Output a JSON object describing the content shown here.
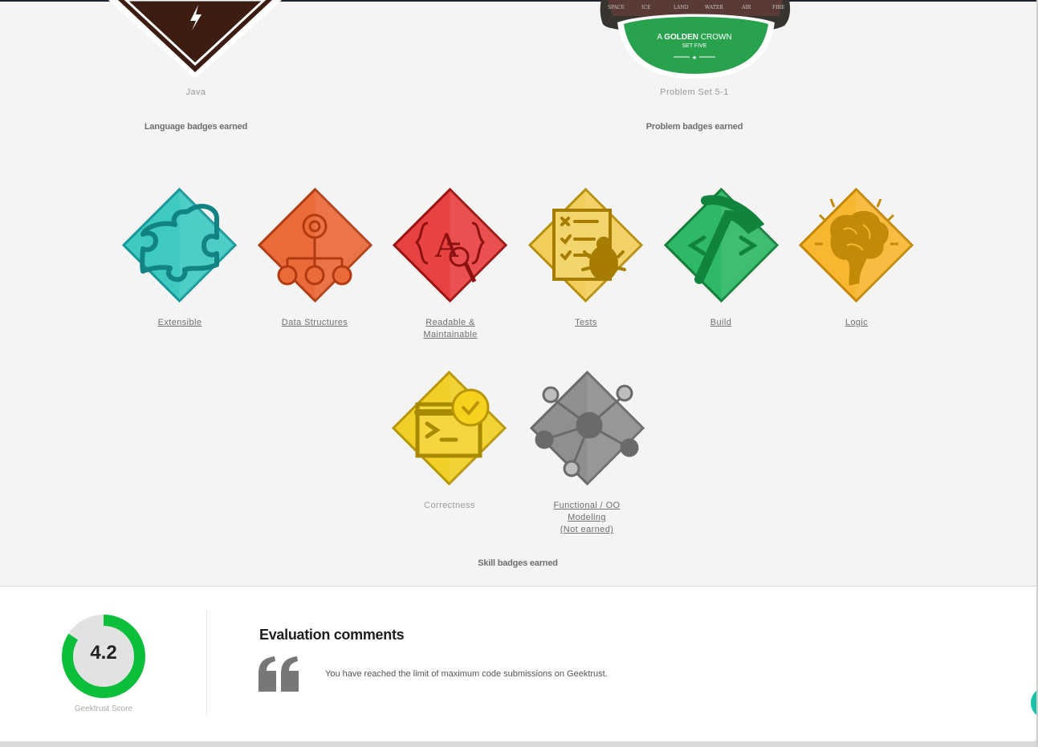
{
  "language_section": {
    "badge_name": "Java",
    "heading": "Language badges earned"
  },
  "problem_section": {
    "badge_name": "Problem Set 5-1",
    "heading": "Problem badges earned",
    "banner_words": [
      "SPACE",
      "ICE",
      "LAND",
      "WATER",
      "AIR",
      "FIRE"
    ],
    "emblem_line1_prefix": "A",
    "emblem_line1_bold": "GOLDEN",
    "emblem_line1_suffix": "CROWN",
    "emblem_line2": "SET FIVE",
    "emblem_star": "★"
  },
  "skills_section": {
    "heading": "Skill badges earned",
    "badges": [
      {
        "name": "Extensible",
        "icon": "puzzle-icon",
        "color": "#3ec9c1",
        "earned": true
      },
      {
        "name": "Data Structures",
        "icon": "tree-structure-icon",
        "color": "#ea6a3a",
        "earned": true
      },
      {
        "name": "Readable &",
        "name_line2": "Maintainable",
        "icon": "magnifier-text-icon",
        "color": "#e94242",
        "earned": true
      },
      {
        "name": "Tests",
        "icon": "checklist-bug-icon",
        "color": "#f2cf5c",
        "earned": true
      },
      {
        "name": "Build",
        "icon": "code-hammer-icon",
        "color": "#2fb865",
        "earned": true
      },
      {
        "name": "Logic",
        "icon": "brain-icon",
        "color": "#f7b731",
        "earned": true
      },
      {
        "name": "Correctness",
        "icon": "terminal-check-icon",
        "color": "#f0cf27",
        "earned": true
      },
      {
        "name": "Functional / OO",
        "name_line2": "Modeling",
        "name_line3": "(Not earned)",
        "icon": "network-nodes-icon",
        "color": "#8f8f8f",
        "earned": false
      }
    ]
  },
  "score": {
    "value": "4.2",
    "fraction": 0.84,
    "label": "Geektrust Score",
    "color": "#0bbf3a"
  },
  "evaluation": {
    "title": "Evaluation comments",
    "comment": "You have reached the limit of maximum code submissions on Geektrust."
  }
}
